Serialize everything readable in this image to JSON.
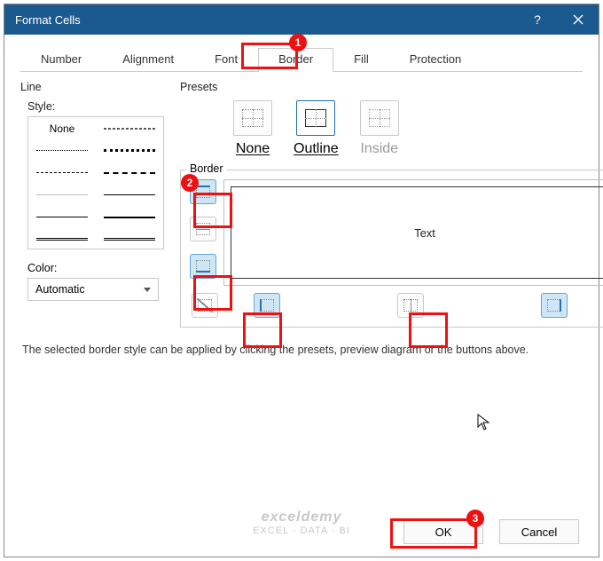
{
  "title": "Format Cells",
  "tabs": [
    "Number",
    "Alignment",
    "Font",
    "Border",
    "Fill",
    "Protection"
  ],
  "activeTab": 3,
  "line": {
    "group": "Line",
    "styleLabel": "Style:",
    "none": "None",
    "colorLabel": "Color:",
    "colorValue": "Automatic"
  },
  "presets": {
    "group": "Presets",
    "none": "None",
    "outline": "Outline",
    "inside": "Inside"
  },
  "border": {
    "group": "Border",
    "previewText": "Text"
  },
  "hint": "The selected border style can be applied by clicking the presets, preview diagram or the buttons above.",
  "buttons": {
    "ok": "OK",
    "cancel": "Cancel"
  },
  "watermark": {
    "brand": "exceldemy",
    "tag": "EXCEL · DATA · BI"
  },
  "callouts": {
    "c1": "1",
    "c2": "2",
    "c3": "3"
  }
}
